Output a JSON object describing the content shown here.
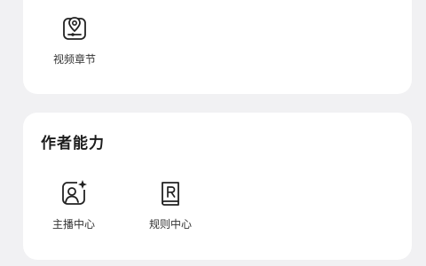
{
  "top_card": {
    "tools": [
      {
        "label": "视频章节",
        "icon": "map-pin-video-icon"
      }
    ]
  },
  "creator_card": {
    "title": "作者能力",
    "tools": [
      {
        "label": "主播中心",
        "icon": "user-sparkle-icon"
      },
      {
        "label": "规则中心",
        "icon": "rules-book-icon"
      }
    ]
  },
  "colors": {
    "background": "#f1f1f3",
    "card": "#ffffff",
    "accent_ring": "#e8423a",
    "icon_stroke": "#222222"
  }
}
